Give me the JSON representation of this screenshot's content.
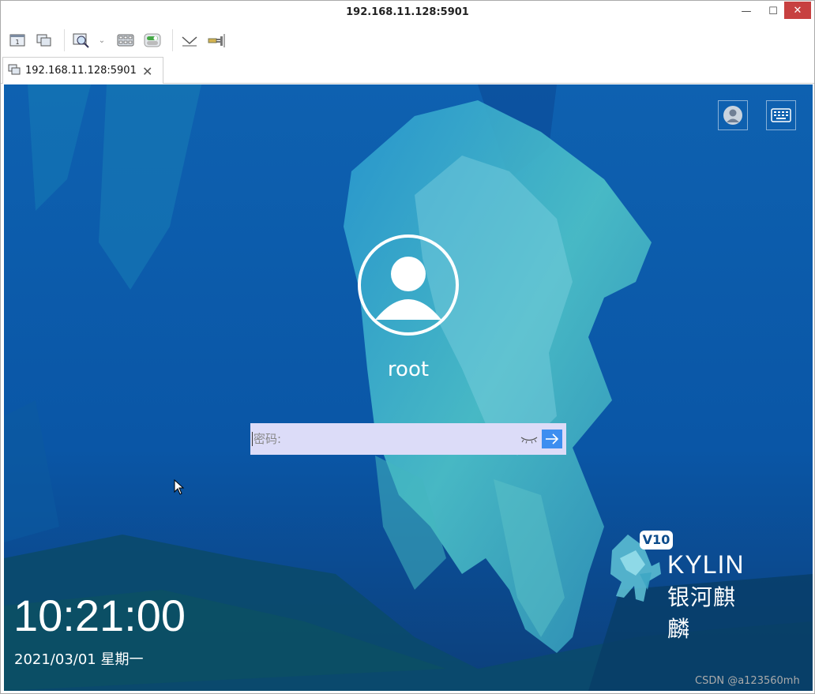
{
  "window": {
    "title": "192.168.11.128:5901",
    "controls": {
      "min": "—",
      "max": "☐",
      "close": "✕"
    }
  },
  "toolbar": {
    "icons": [
      "new-connection-icon",
      "windows-icon",
      "zoom-search-icon",
      "keyboard-grid-icon",
      "toggle-icon",
      "collapse-toolbar-icon",
      "plugin-icon"
    ]
  },
  "tab": {
    "label": "192.168.11.128:5901",
    "close": "✕"
  },
  "login": {
    "username": "root",
    "password_placeholder": "密码:",
    "clock": "10:21:00",
    "date": "2021/03/01 星期一"
  },
  "branding": {
    "version": "V10",
    "name": "KYLIN",
    "name_cn": "银河麒麟"
  },
  "watermark": "CSDN @a123560mh",
  "colors": {
    "bg_blue": "#0b58a8",
    "ice": "#4ec3d0",
    "accent": "#3d8ef0",
    "input_bg": "#dcdcf8"
  }
}
